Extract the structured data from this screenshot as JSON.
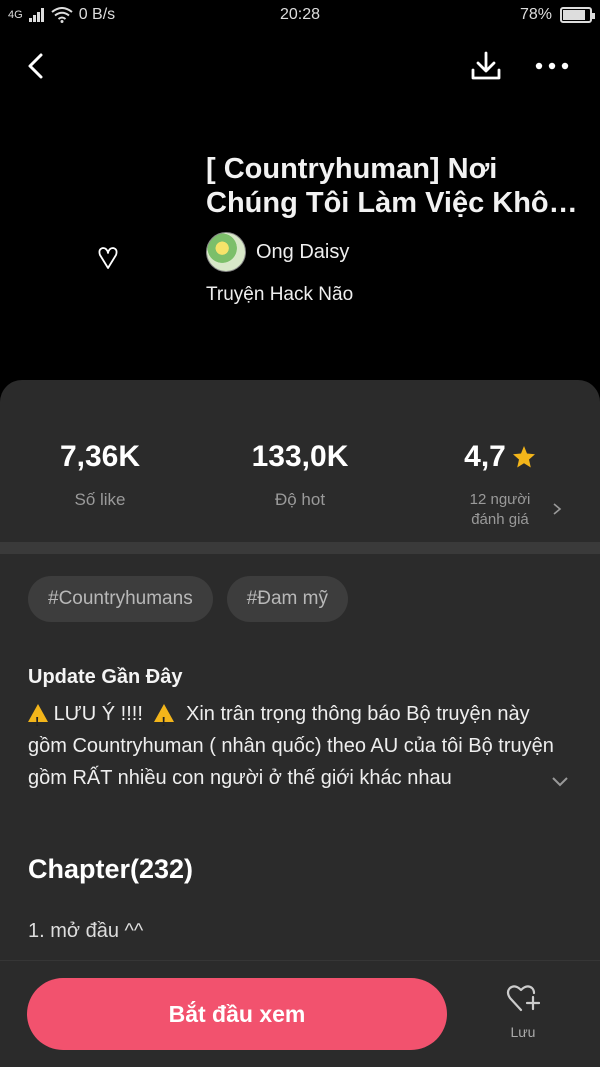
{
  "status_bar": {
    "signal": "4G",
    "speed": "0 B/s",
    "time": "20:28",
    "battery": "78%"
  },
  "story": {
    "title": "[ Countryhuman] Nơi Chúng Tôi Làm Việc Không Được Bình Thường",
    "author": "Ong Daisy",
    "genre": "Truyện Hack Não"
  },
  "stats": {
    "likes": {
      "value": "7,36K",
      "label": "Số like"
    },
    "hot": {
      "value": "133,0K",
      "label": "Độ hot"
    },
    "rating": {
      "value": "4,7",
      "label_line1": "12 người",
      "label_line2": "đánh giá"
    }
  },
  "tags": [
    "#Countryhumans",
    "#Đam mỹ"
  ],
  "update": {
    "title": "Update Gần Đây",
    "warning_text": "LƯU Ý !!!!",
    "body": "Xin trân trọng thông báo  Bộ truyện này gồm Countryhuman ( nhân quốc) theo AU của tôi  Bộ truyện gồm RẤT nhiều con người ở thế giới khác nhau"
  },
  "chapters": {
    "title": "Chapter(232)",
    "first": "1. mở đầu ^^"
  },
  "actions": {
    "start_label": "Bắt đầu xem",
    "save_label": "Lưu"
  },
  "colors": {
    "accent": "#f2526e",
    "panel": "#2b2b2b",
    "star": "#f3b51a"
  }
}
